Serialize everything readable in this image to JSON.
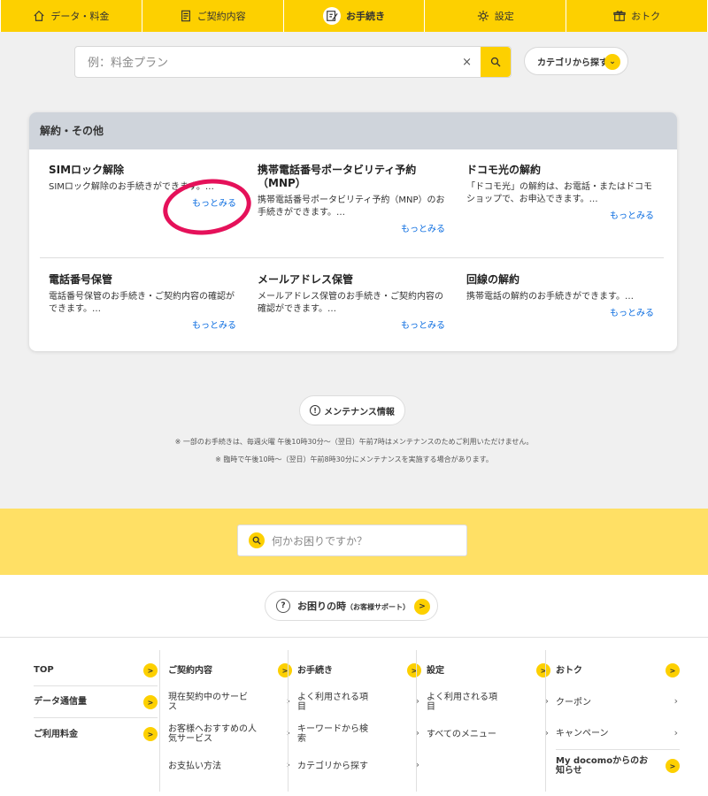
{
  "nav": {
    "tabs": [
      {
        "label": "データ・料金",
        "icon": "home-icon"
      },
      {
        "label": "ご契約内容",
        "icon": "document-icon"
      },
      {
        "label": "お手続き",
        "icon": "pencil-note-icon",
        "active": true
      },
      {
        "label": "設定",
        "icon": "gear-icon"
      },
      {
        "label": "おトク",
        "icon": "gift-icon"
      }
    ]
  },
  "search": {
    "placeholder": "例：料金プラン",
    "clear": "×",
    "category_label": "カテゴリから探す"
  },
  "card": {
    "heading": "解約・その他",
    "items": [
      {
        "title": "SIMロック解除",
        "desc": "SIMロック解除のお手続きができます。…",
        "more": "もっとみる"
      },
      {
        "title": "携帯電話番号ポータビリティ予約（MNP）",
        "desc": "携帯電話番号ポータビリティ予約（MNP）のお手続きができます。…",
        "more": "もっとみる"
      },
      {
        "title": "ドコモ光の解約",
        "desc": "「ドコモ光」の解約は、お電話・またはドコモショップで、お申込できます。…",
        "more": "もっとみる"
      },
      {
        "title": "電話番号保管",
        "desc": "電話番号保管のお手続き・ご契約内容の確認ができます。…",
        "more": "もっとみる"
      },
      {
        "title": "メールアドレス保管",
        "desc": "メールアドレス保管のお手続き・ご契約内容の確認ができます。…",
        "more": "もっとみる"
      },
      {
        "title": "回線の解約",
        "desc": "携帯電話の解約のお手続きができます。…",
        "more": "もっとみる"
      }
    ]
  },
  "maintenance": {
    "label": "メンテナンス情報"
  },
  "notes": [
    "※ 一部のお手続きは、毎週火曜 午後10時30分～（翌日）午前7時はメンテナンスのためご利用いただけません。",
    "※ 臨時で午後10時～（翌日）午前8時30分にメンテナンスを実施する場合があります。"
  ],
  "help_search": {
    "placeholder": "何かお困りですか？"
  },
  "support": {
    "label": "お困りの時",
    "sub": "（お客様サポート）"
  },
  "footer": {
    "cols": [
      {
        "items": [
          {
            "label": "TOP",
            "bold": true
          },
          {
            "label": "データ通信量",
            "bold": true
          },
          {
            "label": "ご利用料金",
            "bold": true
          }
        ]
      },
      {
        "items": [
          {
            "label": "ご契約内容",
            "bold": true
          },
          {
            "label": "現在契約中のサービス"
          },
          {
            "label": "お客様へおすすめの人気サービス"
          },
          {
            "label": "お支払い方法"
          }
        ]
      },
      {
        "items": [
          {
            "label": "お手続き",
            "bold": true
          },
          {
            "label": "よく利用される項目"
          },
          {
            "label": "キーワードから検索"
          },
          {
            "label": "カテゴリから探す"
          }
        ]
      },
      {
        "items": [
          {
            "label": "設定",
            "bold": true
          },
          {
            "label": "よく利用される項目"
          },
          {
            "label": "すべてのメニュー"
          }
        ]
      },
      {
        "items": [
          {
            "label": "おトク",
            "bold": true
          },
          {
            "label": "クーポン"
          },
          {
            "label": "キャンペーン"
          },
          {
            "label": "My docomoからのお知らせ",
            "bold": true
          }
        ]
      }
    ]
  }
}
